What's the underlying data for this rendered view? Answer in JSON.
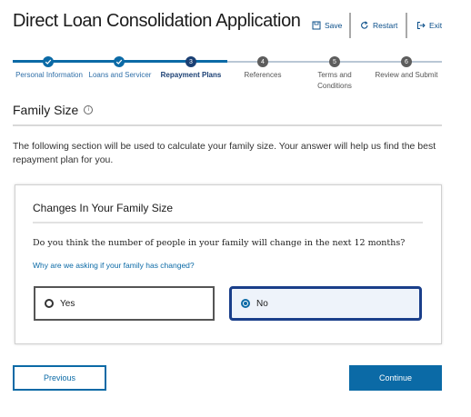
{
  "header": {
    "title": "Direct Loan Consolidation Application",
    "save_label": "Save",
    "restart_label": "Restart",
    "exit_label": "Exit"
  },
  "stepper": {
    "steps": [
      {
        "number": "",
        "label": "Personal Information",
        "state": "done"
      },
      {
        "number": "",
        "label": "Loans and Servicer",
        "state": "done"
      },
      {
        "number": "3",
        "label": "Repayment Plans",
        "state": "current"
      },
      {
        "number": "4",
        "label": "References",
        "state": "todo"
      },
      {
        "number": "5",
        "label_line1": "Terms and",
        "label_line2": "Conditions",
        "state": "todo"
      },
      {
        "number": "6",
        "label": "Review and Submit",
        "state": "todo"
      }
    ]
  },
  "section": {
    "title": "Family Size",
    "info_icon": "i",
    "description": "The following section will be used to calculate your family size. Your answer will help us find the best repayment plan for you."
  },
  "card": {
    "title": "Changes In Your Family Size",
    "question": "Do you think the number of people in your family will change in the next 12 months?",
    "why_link": "Why are we asking if your family has changed?",
    "options": [
      {
        "label": "Yes",
        "selected": false
      },
      {
        "label": "No",
        "selected": true
      }
    ]
  },
  "footer": {
    "previous_label": "Previous",
    "continue_label": "Continue"
  },
  "colors": {
    "primary": "#0b6aa6",
    "current_step": "#1a3f73",
    "selected_border": "#1a3f8a"
  }
}
